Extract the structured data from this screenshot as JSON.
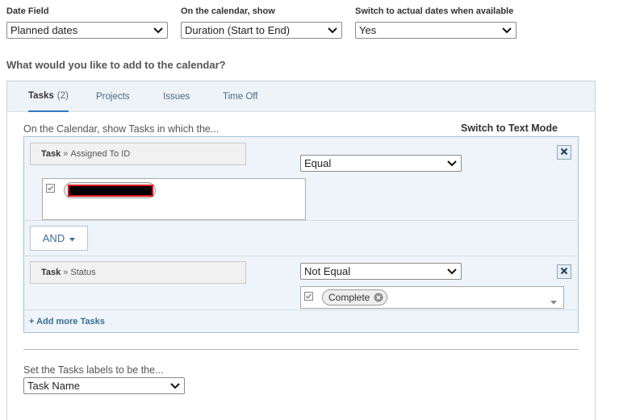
{
  "top_fields": {
    "date_field": {
      "label": "Date Field",
      "value": "Planned dates"
    },
    "show_on_calendar": {
      "label": "On the calendar, show",
      "value": "Duration (Start to End)"
    },
    "switch_actual": {
      "label": "Switch to actual dates when available",
      "value": "Yes"
    }
  },
  "question": "What would you like to add to the calendar?",
  "tabs": [
    {
      "label": "Tasks",
      "count": "(2)",
      "active": true
    },
    {
      "label": "Projects"
    },
    {
      "label": "Issues"
    },
    {
      "label": "Time Off"
    }
  ],
  "filters": {
    "hint": "On the Calendar, show Tasks in which the...",
    "switch_mode": "Switch to Text Mode",
    "rows": [
      {
        "object": "Task",
        "sep": "»",
        "field": "Assigned To ID",
        "operator": "Equal",
        "value_pill": ""
      },
      {
        "object": "Task",
        "sep": "»",
        "field": "Status",
        "operator": "Not Equal",
        "value_pill": "Complete"
      }
    ],
    "conjunction": "AND",
    "add_more": "+ Add more Tasks"
  },
  "labels": {
    "hint": "Set the Tasks labels to be the...",
    "value": "Task Name"
  },
  "colors": {
    "accent": "#2f79c0",
    "redaction_border": "#e0161b",
    "filter_bg": "#eef4f9"
  },
  "icons": [
    "chevron-down-icon",
    "close-icon",
    "checkbox-icon",
    "pill-remove-icon",
    "caret-down-icon"
  ]
}
